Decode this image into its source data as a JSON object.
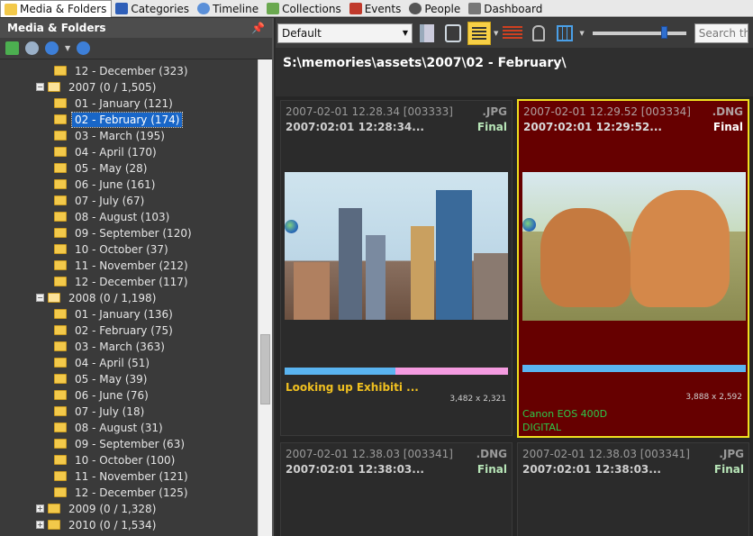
{
  "tabs": [
    {
      "label": "Media & Folders",
      "icon": "folder-icon",
      "active": true
    },
    {
      "label": "Categories",
      "icon": "categories-icon"
    },
    {
      "label": "Timeline",
      "icon": "timeline-icon"
    },
    {
      "label": "Collections",
      "icon": "collections-icon"
    },
    {
      "label": "Events",
      "icon": "events-icon"
    },
    {
      "label": "People",
      "icon": "people-icon"
    },
    {
      "label": "Dashboard",
      "icon": "dashboard-icon"
    }
  ],
  "panel": {
    "title": "Media & Folders",
    "pin_icon": "pin-icon"
  },
  "tree": [
    {
      "label": "12 - December (323)",
      "level": 2
    },
    {
      "label": "2007 (0 / 1,505)",
      "level": 1,
      "expanded": true
    },
    {
      "label": "01 - January (121)",
      "level": 2
    },
    {
      "label": "02 - February (174)",
      "level": 2,
      "selected": true
    },
    {
      "label": "03 - March (195)",
      "level": 2
    },
    {
      "label": "04 - April (170)",
      "level": 2
    },
    {
      "label": "05 - May (28)",
      "level": 2
    },
    {
      "label": "06 - June (161)",
      "level": 2
    },
    {
      "label": "07 - July (67)",
      "level": 2
    },
    {
      "label": "08 - August (103)",
      "level": 2
    },
    {
      "label": "09 - September (120)",
      "level": 2
    },
    {
      "label": "10 - October (37)",
      "level": 2
    },
    {
      "label": "11 - November (212)",
      "level": 2
    },
    {
      "label": "12 - December (117)",
      "level": 2
    },
    {
      "label": "2008 (0 / 1,198)",
      "level": 1,
      "expanded": true
    },
    {
      "label": "01 - January (136)",
      "level": 2
    },
    {
      "label": "02 - February (75)",
      "level": 2
    },
    {
      "label": "03 - March (363)",
      "level": 2
    },
    {
      "label": "04 - April (51)",
      "level": 2
    },
    {
      "label": "05 - May (39)",
      "level": 2
    },
    {
      "label": "06 - June (76)",
      "level": 2
    },
    {
      "label": "07 - July (18)",
      "level": 2
    },
    {
      "label": "08 - August (31)",
      "level": 2
    },
    {
      "label": "09 - September (63)",
      "level": 2
    },
    {
      "label": "10 - October (100)",
      "level": 2
    },
    {
      "label": "11 - November (121)",
      "level": 2
    },
    {
      "label": "12 - December (125)",
      "level": 2
    },
    {
      "label": "2009 (0 / 1,328)",
      "level": 1,
      "expanded": false
    },
    {
      "label": "2010 (0 / 1,534)",
      "level": 1,
      "expanded": false
    }
  ],
  "toolbar": {
    "sort_value": "Default",
    "search_placeholder": "Search the"
  },
  "path": "S:\\memories\\assets\\2007\\02 - February\\",
  "cards": [
    {
      "file": "2007-02-01 12.28.34 [003333]",
      "ext": ".JPG",
      "date": "2007:02:01 12:28:34...",
      "status": "Final",
      "title": "Looking up Exhibiti ...",
      "dims": "3,482 x 2,321",
      "selected": false
    },
    {
      "file": "2007-02-01 12.29.52 [003334]",
      "ext": ".DNG",
      "date": "2007:02:01 12:29:52...",
      "status": "Final",
      "dims": "3,888 x 2,592",
      "camera_make": "Canon EOS 400D",
      "camera_model": "DIGITAL",
      "selected": true
    },
    {
      "file": "2007-02-01 12.38.03 [003341]",
      "ext": ".DNG",
      "date": "2007:02:01 12:38:03...",
      "status": "Final"
    },
    {
      "file": "2007-02-01 12.38.03 [003341]",
      "ext": ".JPG",
      "date": "2007:02:01 12:38:03...",
      "status": "Final"
    }
  ],
  "colors": {
    "selection": "#1866c8",
    "card_selected_bg": "#660000",
    "card_selected_border": "#f0e020",
    "title_gold": "#f0c020",
    "camera_green": "#2ec84a",
    "bar_blue": "#5ab4f0",
    "bar_pink": "#f49be0"
  }
}
